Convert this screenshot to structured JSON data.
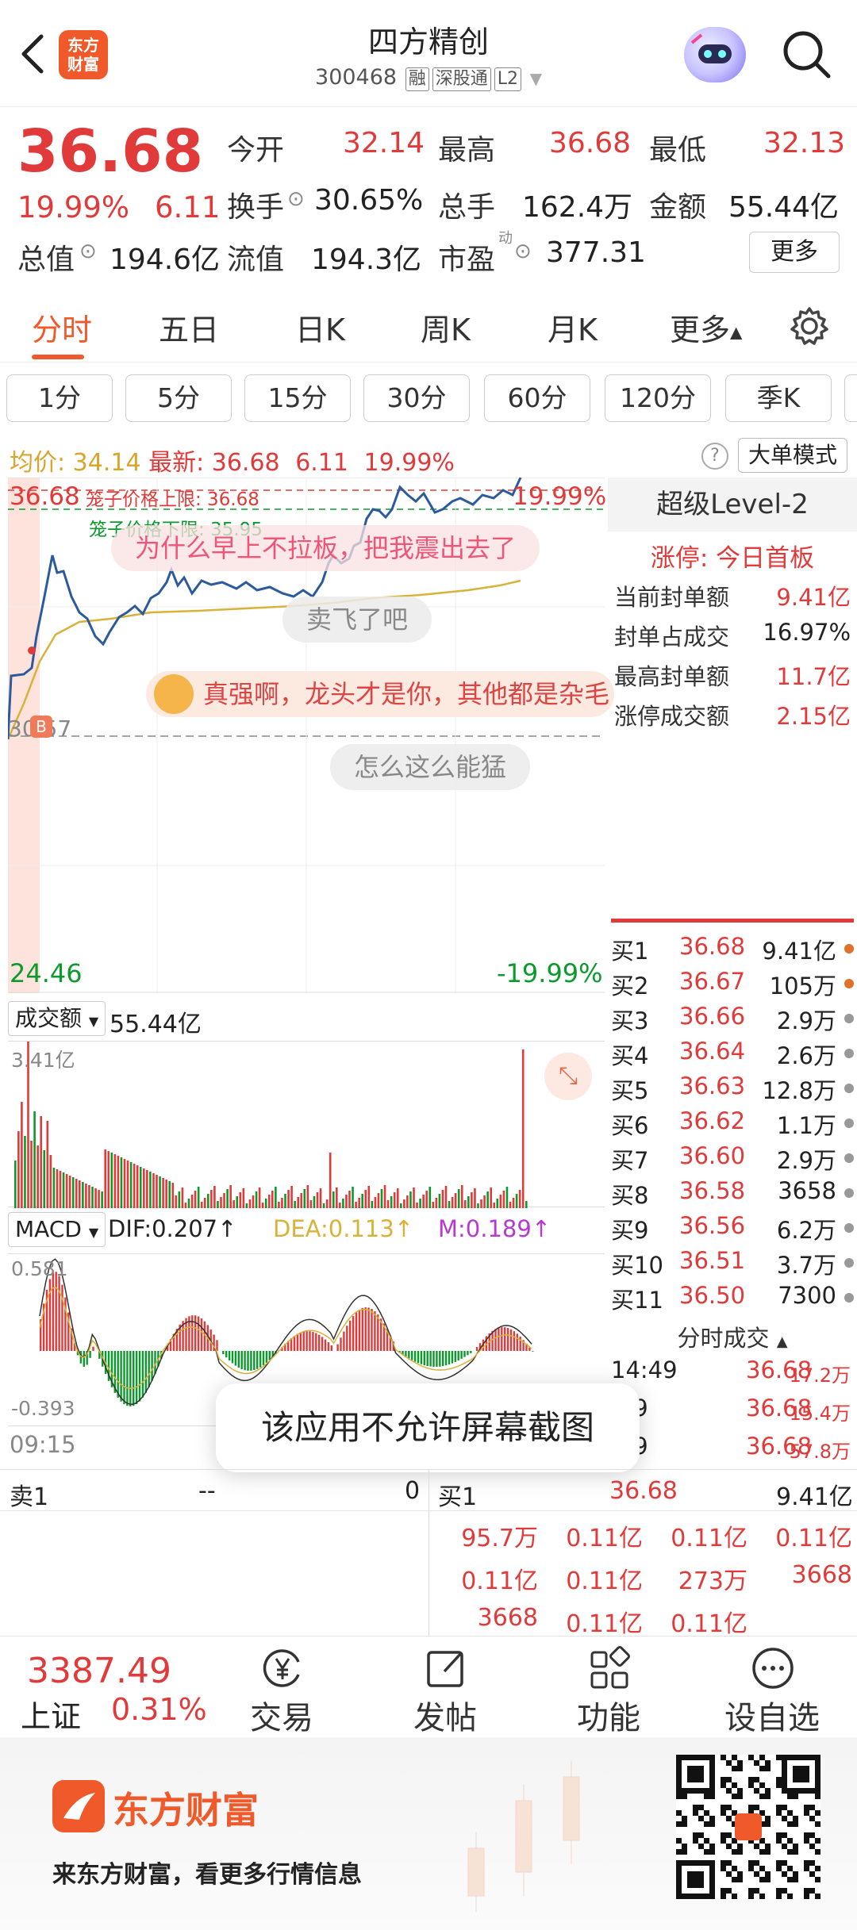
{
  "header": {
    "logo_line1": "东方",
    "logo_line2": "财富",
    "stock_name": "四方精创",
    "stock_code": "300468",
    "tag_rong": "融",
    "tag_sgt": "深股通",
    "tag_l2": "L2"
  },
  "quote": {
    "price": "36.68",
    "change_pct": "19.99%",
    "change_abs": "6.11",
    "open_label": "今开",
    "open": "32.14",
    "high_label": "最高",
    "high": "36.68",
    "low_label": "最低",
    "low": "32.13",
    "turnover_label": "换手",
    "turnover": "30.65%",
    "volume_label": "总手",
    "volume": "162.4万",
    "amount_label": "金额",
    "amount": "55.44亿",
    "mktcap_label": "总值",
    "mktcap": "194.6亿",
    "float_label": "流值",
    "float_cap": "194.3亿",
    "pe_label": "市盈",
    "pe_sup": "动",
    "pe": "377.31",
    "more_label": "更多"
  },
  "tabs": [
    "分时",
    "五日",
    "日K",
    "周K",
    "月K",
    "更多"
  ],
  "intervals": [
    "1分",
    "5分",
    "15分",
    "30分",
    "60分",
    "120分",
    "季K"
  ],
  "chart_info": {
    "avg_label": "均价:",
    "avg": "34.14",
    "latest_label": "最新:",
    "latest": "36.68",
    "chg": "6.11",
    "pct": "19.99%",
    "bigorder_label": "大单模式"
  },
  "main_chart": {
    "top_price": "36.68",
    "top_pct": "19.99%",
    "cage_upper": "笼子价格上限: 36.68",
    "cage_lower": "笼子价格下限: 35.95",
    "prev_close": "30.57",
    "bottom_price": "24.46",
    "bottom_pct": "-19.99%",
    "marker": "B",
    "time_start": "09:15"
  },
  "comments": [
    "为什么早上不拉板，把我震出去了",
    "卖飞了吧",
    "真强啊，龙头才是你，其他都是杂毛",
    "怎么这么能猛"
  ],
  "right_panel": {
    "title": "超级Level-2",
    "limit_label": "涨停: 今日首板",
    "stats": [
      {
        "label": "当前封单额",
        "value": "9.41亿"
      },
      {
        "label": "封单占成交",
        "value": "16.97%"
      },
      {
        "label": "最高封单额",
        "value": "11.7亿"
      },
      {
        "label": "涨停成交额",
        "value": "2.15亿"
      }
    ],
    "orders": [
      {
        "label": "买1",
        "price": "36.68",
        "vol": "9.41亿",
        "dot": "orange"
      },
      {
        "label": "买2",
        "price": "36.67",
        "vol": "105万",
        "dot": "orange"
      },
      {
        "label": "买3",
        "price": "36.66",
        "vol": "2.9万",
        "dot": "gray"
      },
      {
        "label": "买4",
        "price": "36.64",
        "vol": "2.6万",
        "dot": "gray"
      },
      {
        "label": "买5",
        "price": "36.63",
        "vol": "12.8万",
        "dot": "gray"
      },
      {
        "label": "买6",
        "price": "36.62",
        "vol": "1.1万",
        "dot": "gray"
      },
      {
        "label": "买7",
        "price": "36.60",
        "vol": "2.9万",
        "dot": "gray"
      },
      {
        "label": "买8",
        "price": "36.58",
        "vol": "3658",
        "dot": "gray"
      },
      {
        "label": "买9",
        "price": "36.56",
        "vol": "6.2万",
        "dot": "gray"
      },
      {
        "label": "买10",
        "price": "36.51",
        "vol": "3.7万",
        "dot": "gray"
      },
      {
        "label": "买11",
        "price": "36.50",
        "vol": "7300",
        "dot": "gray"
      }
    ],
    "ticks_label": "分时成交",
    "ticks": [
      {
        "time": "14:49",
        "price": "36.68",
        "vol": "17.2万"
      },
      {
        "time": ":49",
        "price": "36.68",
        "vol": "15.4万"
      },
      {
        "time": ":49",
        "price": "36.68",
        "vol": "57.8万"
      }
    ]
  },
  "volume_panel": {
    "selector": "成交额",
    "total": "55.44亿",
    "max": "3.41亿"
  },
  "macd_panel": {
    "selector": "MACD",
    "dif": "DIF:0.207",
    "dea": "DEA:0.113",
    "m": "M:0.189",
    "max": "0.581",
    "min": "-0.393"
  },
  "toast": "该应用不允许屏幕截图",
  "bottom_table": {
    "sell1_label": "卖1",
    "sell1_price": "--",
    "sell1_vol": "0",
    "buy1_label": "买1",
    "buy1_price": "36.68",
    "buy1_vol": "9.41亿",
    "rows": [
      [
        "95.7万",
        "0.11亿",
        "0.11亿",
        "0.11亿"
      ],
      [
        "0.11亿",
        "0.11亿",
        "273万",
        "3668"
      ],
      [
        "3668",
        "0.11亿",
        "0.11亿",
        ""
      ]
    ]
  },
  "index": {
    "value": "3387.49",
    "name": "上证",
    "pct": "0.31%"
  },
  "nav": [
    "交易",
    "发帖",
    "功能",
    "设自选"
  ],
  "footer": {
    "brand": "东方财富",
    "slogan": "来东方财富，看更多行情信息"
  },
  "colors": {
    "up": "#e03a3a",
    "down": "#0c9a2c",
    "accent": "#f0592a",
    "price_line": "#2c5a9c",
    "avg_line": "#d9b23a"
  }
}
